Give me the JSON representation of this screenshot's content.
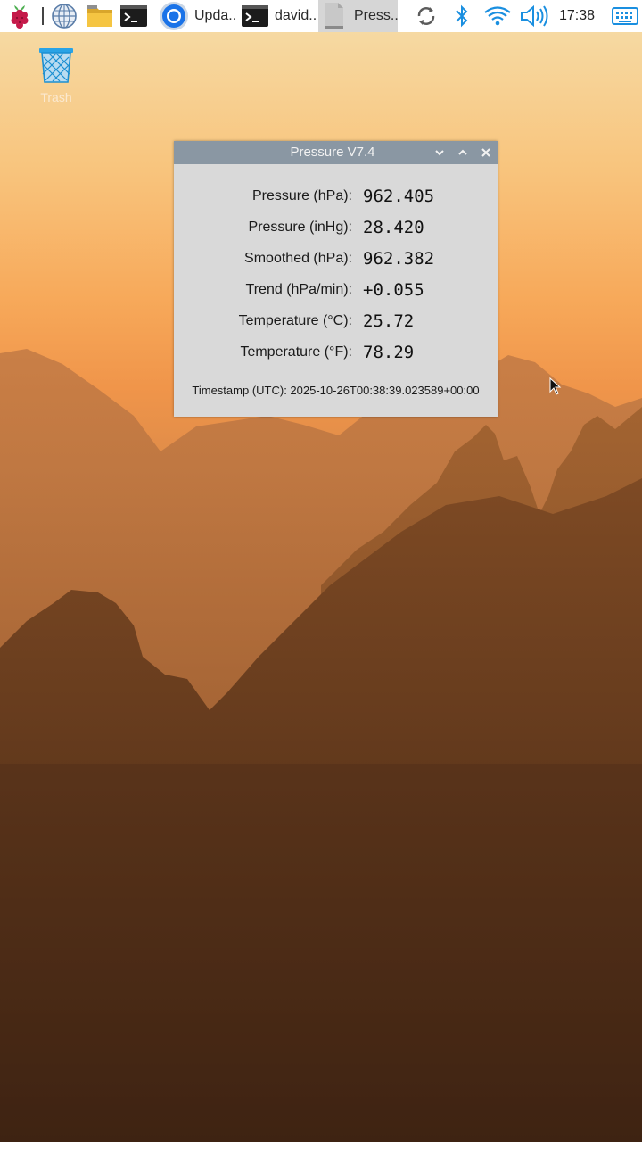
{
  "taskbar": {
    "apps": [
      {
        "name": "raspberry-menu-icon"
      },
      {
        "name": "web-browser-icon"
      },
      {
        "name": "file-manager-icon"
      },
      {
        "name": "terminal-icon"
      }
    ],
    "tasks": [
      {
        "label": "Upda..",
        "icon": "chromium-icon"
      },
      {
        "label": "david..",
        "icon": "terminal-icon"
      },
      {
        "label": "Press..",
        "icon": "document-icon",
        "active": true
      }
    ],
    "tray": [
      "sync-icon",
      "bluetooth-icon",
      "wifi-icon",
      "volume-icon"
    ],
    "clock": "17:38",
    "keyboard_icon": "keyboard-icon"
  },
  "desktop": {
    "trash_label": "Trash"
  },
  "window": {
    "title": "Pressure V7.4",
    "rows": [
      {
        "label": "Pressure (hPa):",
        "value": "962.405"
      },
      {
        "label": "Pressure (inHg):",
        "value": "28.420"
      },
      {
        "label": "Smoothed (hPa):",
        "value": "962.382"
      },
      {
        "label": "Trend (hPa/min):",
        "value": "+0.055"
      },
      {
        "label": "Temperature (°C):",
        "value": "25.72"
      },
      {
        "label": "Temperature (°F):",
        "value": "78.29"
      }
    ],
    "timestamp": "Timestamp (UTC): 2025-10-26T00:38:39.023589+00:00"
  },
  "colors": {
    "titlebar": "#8a97a3",
    "window_bg": "#d9d9d9",
    "active_task": "#d6d6d6",
    "accent_blue": "#1a8fe0"
  }
}
